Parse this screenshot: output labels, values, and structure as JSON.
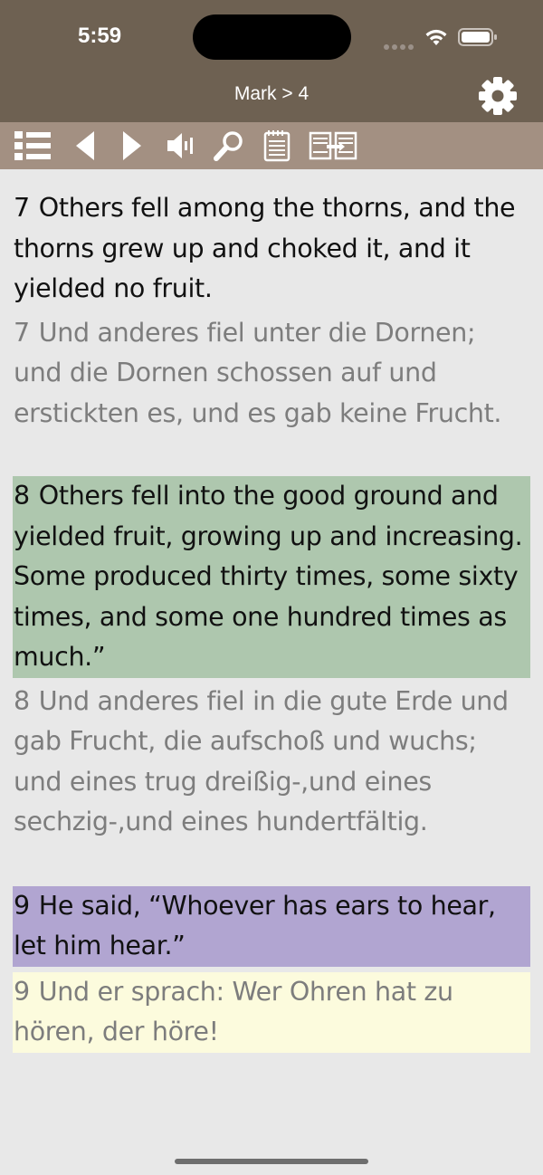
{
  "status_bar": {
    "time": "5:59"
  },
  "nav": {
    "title": "Mark > 4",
    "settings_icon": "gear-icon"
  },
  "toolbar": {
    "icons": [
      "list-icon",
      "previous-icon",
      "next-icon",
      "speaker-icon",
      "search-icon",
      "notes-icon",
      "compare-icon"
    ]
  },
  "colors": {
    "top_bar": "#6e6152",
    "toolbar": "#a39082",
    "background": "#e8e8e8",
    "highlight_green": "#aec7ae",
    "highlight_purple": "#b1a5d1",
    "highlight_yellow": "#fcfbdd"
  },
  "verses": [
    {
      "number": "7",
      "english": "Others fell among the thorns, and the thorns grew up and choked it, and it yielded no fruit.",
      "german": "Und anderes fiel unter die Dornen; und die Dornen schossen auf und erstickten es, und es gab keine Frucht."
    },
    {
      "number": "8",
      "english": "Others fell into the good ground and yielded fruit, growing up and increasing. Some produced thirty times, some sixty times, and some one hundred times as much.”",
      "german": "Und anderes fiel in die gute Erde und gab Frucht, die aufschoß und wuchs; und eines trug dreißig-,und eines sechzig-,und eines hundertfältig."
    },
    {
      "number": "9",
      "english": "He said, “Whoever has ears to hear, let him hear.”",
      "german": "Und er sprach: Wer Ohren hat zu hören, der höre!"
    }
  ]
}
